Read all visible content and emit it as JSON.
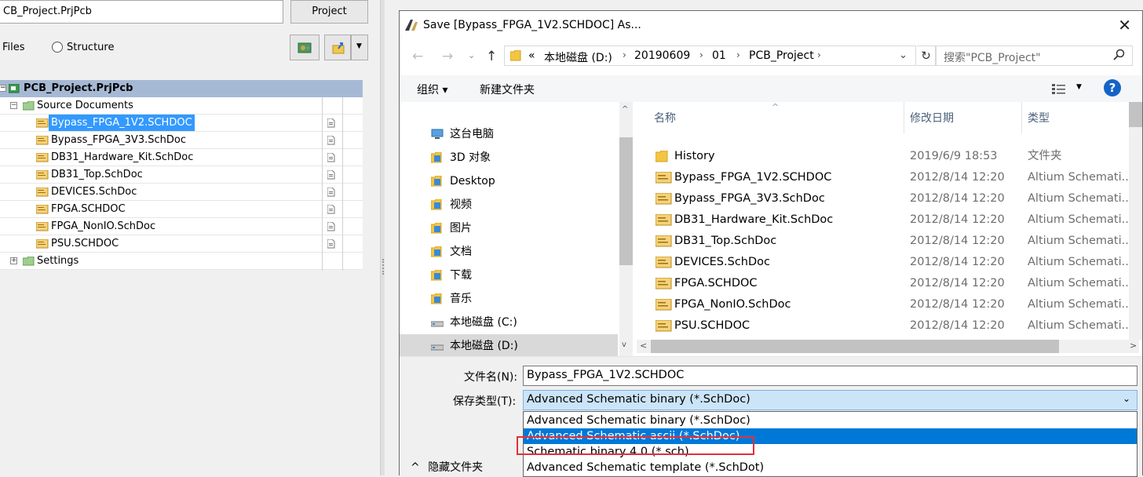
{
  "left_panel": {
    "project_file": "CB_Project.PrjPcb",
    "project_button": "Project",
    "files_label": "Files",
    "structure_label": "Structure",
    "tree": {
      "project": "PCB_Project.PrjPcb",
      "source_folder": "Source Documents",
      "documents": [
        "Bypass_FPGA_1V2.SCHDOC",
        "Bypass_FPGA_3V3.SchDoc",
        "DB31_Hardware_Kit.SchDoc",
        "DB31_Top.SchDoc",
        "DEVICES.SchDoc",
        "FPGA.SCHDOC",
        "FPGA_NonIO.SchDoc",
        "PSU.SCHDOC"
      ],
      "selected_index": 0,
      "settings_folder": "Settings"
    }
  },
  "dialog": {
    "title": "Save [Bypass_FPGA_1V2.SCHDOC] As...",
    "path": [
      "«",
      "本地磁盘 (D:)",
      "20190609",
      "01",
      "PCB_Project"
    ],
    "search_placeholder": "搜索\"PCB_Project\"",
    "organize": "组织 ▾",
    "new_folder": "新建文件夹",
    "help": "?",
    "nav_items": [
      {
        "label": "这台电脑",
        "icon": "computer-icon"
      },
      {
        "label": "3D 对象",
        "icon": "3d-objects-icon"
      },
      {
        "label": "Desktop",
        "icon": "desktop-folder-icon"
      },
      {
        "label": "视频",
        "icon": "video-folder-icon"
      },
      {
        "label": "图片",
        "icon": "picture-folder-icon"
      },
      {
        "label": "文档",
        "icon": "document-folder-icon"
      },
      {
        "label": "下载",
        "icon": "download-folder-icon"
      },
      {
        "label": "音乐",
        "icon": "music-folder-icon"
      },
      {
        "label": "本地磁盘 (C:)",
        "icon": "drive-c-icon"
      },
      {
        "label": "本地磁盘 (D:)",
        "icon": "drive-d-icon"
      }
    ],
    "columns": {
      "name": "名称",
      "date": "修改日期",
      "type": "类型"
    },
    "files": [
      {
        "name": "History",
        "date": "2019/6/9 18:53",
        "type": "文件夹",
        "folder": true
      },
      {
        "name": "Bypass_FPGA_1V2.SCHDOC",
        "date": "2012/8/14 12:20",
        "type": "Altium Schemati..."
      },
      {
        "name": "Bypass_FPGA_3V3.SchDoc",
        "date": "2012/8/14 12:20",
        "type": "Altium Schemati..."
      },
      {
        "name": "DB31_Hardware_Kit.SchDoc",
        "date": "2012/8/14 12:20",
        "type": "Altium Schemati..."
      },
      {
        "name": "DB31_Top.SchDoc",
        "date": "2012/8/14 12:20",
        "type": "Altium Schemati..."
      },
      {
        "name": "DEVICES.SchDoc",
        "date": "2012/8/14 12:20",
        "type": "Altium Schemati..."
      },
      {
        "name": "FPGA.SCHDOC",
        "date": "2012/8/14 12:20",
        "type": "Altium Schemati..."
      },
      {
        "name": "FPGA_NonIO.SchDoc",
        "date": "2012/8/14 12:20",
        "type": "Altium Schemati..."
      },
      {
        "name": "PSU.SCHDOC",
        "date": "2012/8/14 12:20",
        "type": "Altium Schemati..."
      }
    ],
    "filename_label": "文件名(N):",
    "filename_value": "Bypass_FPGA_1V2.SCHDOC",
    "filetype_label": "保存类型(T):",
    "filetype_value": "Advanced Schematic binary (*.SchDoc)",
    "filetype_options": [
      "Advanced Schematic binary (*.SchDoc)",
      "Advanced Schematic ascii (*.SchDoc)",
      "Schematic binary 4.0 (*.sch)",
      "Advanced Schematic template (*.SchDot)"
    ],
    "highlighted_option": 1,
    "hide_folders": "隐藏文件夹"
  }
}
